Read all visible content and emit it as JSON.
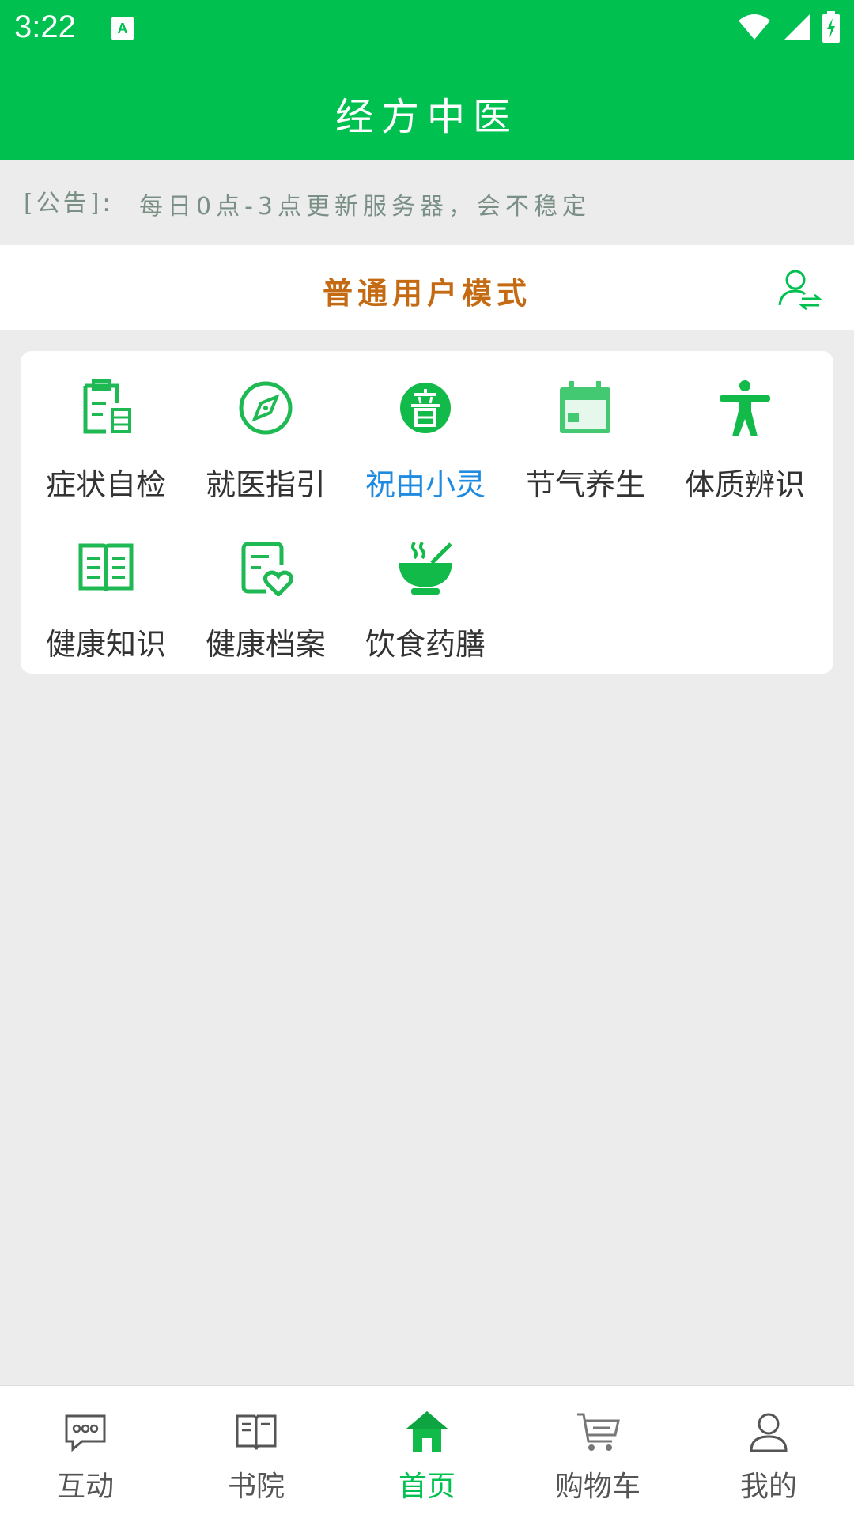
{
  "status_bar": {
    "time": "3:22"
  },
  "header": {
    "title": "经方中医"
  },
  "notice": {
    "prefix": "[公告]:",
    "text": "每日0点-3点更新服务器，会不稳定"
  },
  "mode": {
    "title": "普通用户模式"
  },
  "menu": {
    "items": [
      {
        "label": "症状自检",
        "icon": "clipboard-icon"
      },
      {
        "label": "就医指引",
        "icon": "compass-icon"
      },
      {
        "label": "祝由小灵",
        "icon": "audio-badge-icon",
        "active": true
      },
      {
        "label": "节气养生",
        "icon": "calendar-icon"
      },
      {
        "label": "体质辨识",
        "icon": "person-icon"
      },
      {
        "label": "健康知识",
        "icon": "book-icon"
      },
      {
        "label": "健康档案",
        "icon": "health-record-icon"
      },
      {
        "label": "饮食药膳",
        "icon": "bowl-icon"
      }
    ]
  },
  "tabs": [
    {
      "label": "互动",
      "icon": "chat-icon"
    },
    {
      "label": "书院",
      "icon": "book-open-icon"
    },
    {
      "label": "首页",
      "icon": "home-icon",
      "active": true
    },
    {
      "label": "购物车",
      "icon": "cart-icon"
    },
    {
      "label": "我的",
      "icon": "user-icon"
    }
  ],
  "colors": {
    "brand": "#00c150",
    "mode_text": "#c36a12",
    "active_menu": "#1e8be0"
  }
}
